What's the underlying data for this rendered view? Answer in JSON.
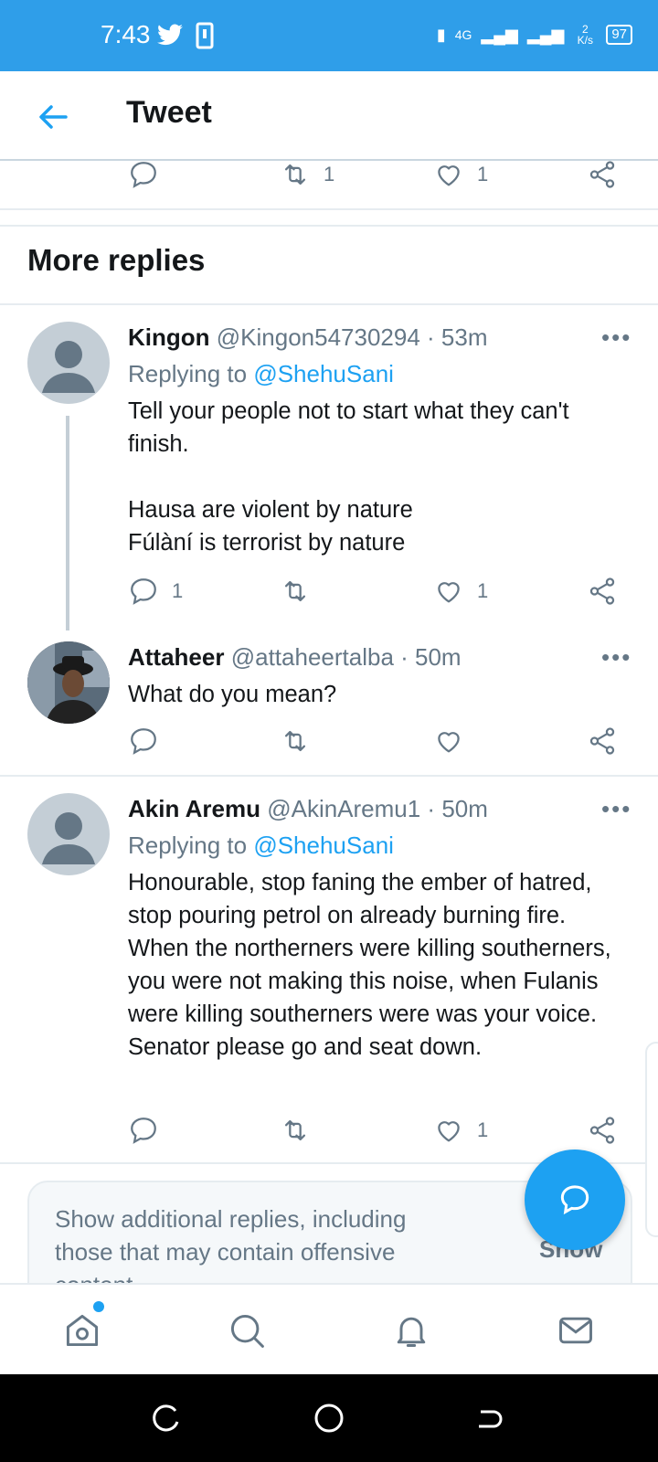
{
  "status": {
    "time": "7:43",
    "network": "4G",
    "speed": "2 K/s",
    "battery": "97"
  },
  "header": {
    "title": "Tweet"
  },
  "top_actions": {
    "retweets": "1",
    "likes": "1"
  },
  "section_title": "More replies",
  "replies": [
    {
      "name": "Kingon",
      "handle": "@Kingon54730294 · 53m",
      "replying_prefix": "Replying to",
      "replying_to": "@ShehuSani",
      "text": "Tell your people not to start what they can't finish.\n\nHausa are violent by nature\nFúlàní is terrorist by nature",
      "replies": "1",
      "retweets": "",
      "likes": "1"
    },
    {
      "name": "Attaheer",
      "handle": "@attaheertalba · 50m",
      "text": "What do you mean?",
      "replies": "",
      "retweets": "",
      "likes": ""
    },
    {
      "name": "Akin Aremu",
      "handle": "@AkinAremu1 · 50m",
      "replying_prefix": "Replying to",
      "replying_to": "@ShehuSani",
      "text": "Honourable, stop faning the ember of hatred, stop pouring petrol on already burning fire. When the northerners were killing southerners,  you were not making this noise, when Fulanis were killing southerners were was your voice. Senator please go and seat down.",
      "replies": "",
      "retweets": "",
      "likes": "1"
    }
  ],
  "notice": {
    "text": "Show additional replies, including those that may contain offensive content",
    "show_label": "Show"
  },
  "more_label": "•••",
  "colors": {
    "status_bar": "#2f9ee9",
    "accent": "#1da1f2",
    "muted": "#657786"
  }
}
